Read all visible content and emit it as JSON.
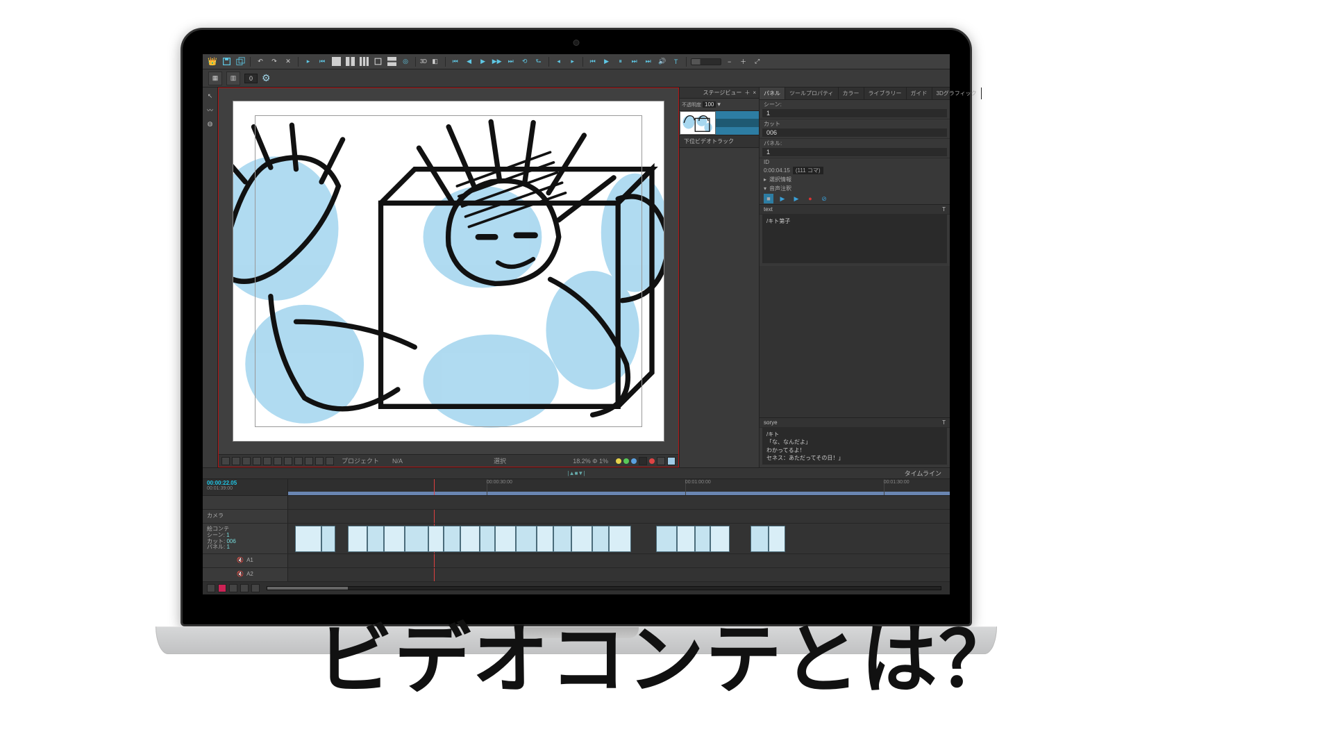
{
  "headline": "ビデオコンテとは？",
  "toolbar": {
    "three_d": "3D"
  },
  "subtoolbar": {
    "zero_box": "0"
  },
  "thumb_panel": {
    "stage_view": "ステージビュー",
    "opacity_label": "不透明度",
    "opacity_value": "100",
    "track_header": "下位ビデオトラック"
  },
  "props": {
    "tabs": [
      "パネル",
      "ツールプロパティ",
      "カラー",
      "ライブラリー",
      "ガイド",
      "3Dグラフィック"
    ],
    "scene_label": "シーン:",
    "scene_value": "1",
    "cut_label": "カット",
    "cut_value": "006",
    "panel_label": "パネル:",
    "panel_value": "1",
    "id_label": "ID",
    "timecode": "0:00:04.15",
    "frames": "(111 コマ)",
    "info_label": "選択情報",
    "audio_label": "音声注釈",
    "notes_hd": "text",
    "notes_label": "/キト第子",
    "section2_hd": "sorye",
    "dialog_lines": [
      "/キト",
      "「な、なんだよ」",
      "わかってるよ！",
      "セネス：あただってその日！」"
    ]
  },
  "timeline": {
    "title": "タイムライン",
    "center": "|▲■▼|",
    "tc": "00:00:22.05",
    "dur": "00:01:39:00",
    "grid": [
      "00:00:30:00",
      "00:01:00:00",
      "00:01:30:00"
    ],
    "playhead_pct": 22,
    "cam_label": "カメラ",
    "storyboard_label": "絵コンテ",
    "scene_line": "シーン:",
    "scene_v": "1",
    "cut_line": "カット:",
    "cut_v": "006",
    "panel_line": "パネル:",
    "panel_v": "1",
    "a1": "A1",
    "a2": "A2"
  },
  "stage_footer": {
    "project": "プロジェクト",
    "na": "N/A",
    "mid": "選択",
    "zoom": "18.2%  Φ 1%"
  }
}
